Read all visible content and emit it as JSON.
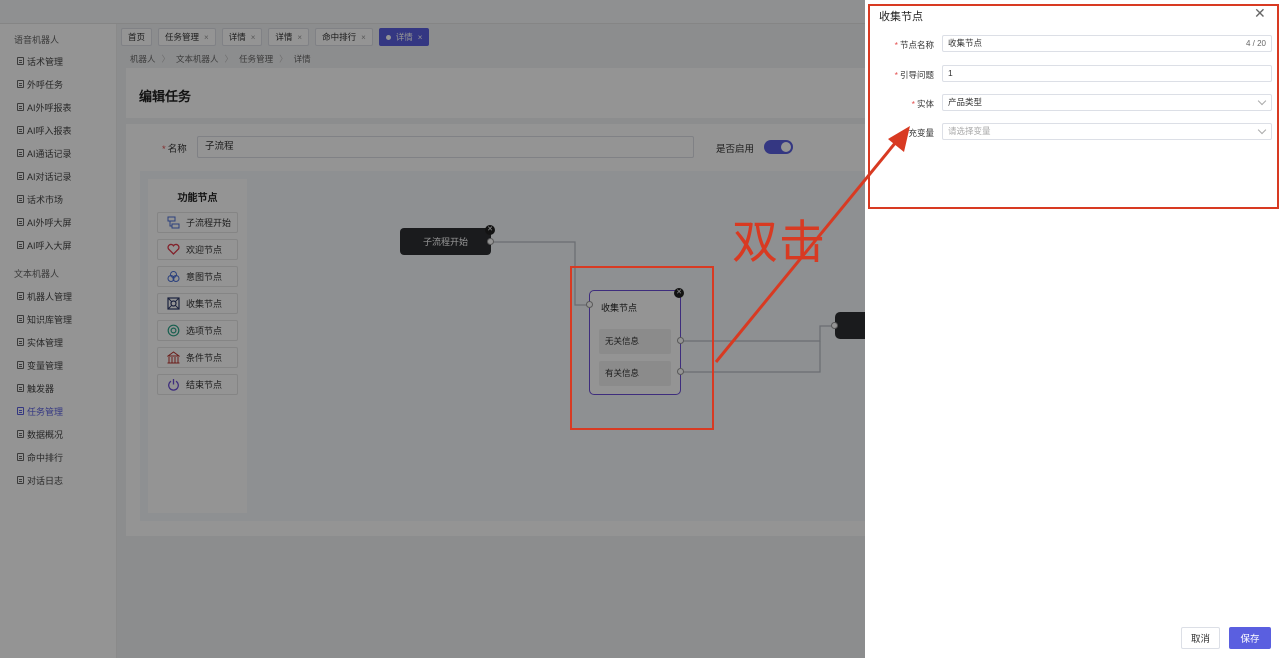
{
  "sidebar": {
    "sections": [
      "语音机器人",
      "文本机器人"
    ],
    "voice_items": [
      "话术管理",
      "外呼任务",
      "AI外呼报表",
      "AI呼入报表",
      "AI通话记录",
      "AI对话记录",
      "话术市场",
      "AI外呼大屏",
      "AI呼入大屏"
    ],
    "text_items": [
      "机器人管理",
      "知识库管理",
      "实体管理",
      "变量管理",
      "触发器",
      "任务管理",
      "数据概况",
      "命中排行",
      "对话日志"
    ],
    "active_item": "任务管理"
  },
  "tabs": [
    {
      "label": "首页",
      "closable": false,
      "active": false
    },
    {
      "label": "任务管理",
      "closable": true,
      "active": false
    },
    {
      "label": "详情",
      "closable": true,
      "active": false
    },
    {
      "label": "详情",
      "closable": true,
      "active": false
    },
    {
      "label": "命中排行",
      "closable": true,
      "active": false
    },
    {
      "label": "详情",
      "closable": true,
      "active": true
    }
  ],
  "tab_close_glyph": "×",
  "breadcrumb": [
    "机器人",
    "文本机器人",
    "任务管理",
    "详情"
  ],
  "breadcrumb_sep": "〉",
  "page": {
    "title": "编辑任务",
    "name_label": "名称",
    "name_value": "子流程",
    "enable_label": "是否启用",
    "enabled": true
  },
  "palette": {
    "title": "功能节点",
    "items": [
      {
        "label": "子流程开始",
        "icon": "subflow-icon"
      },
      {
        "label": "欢迎节点",
        "icon": "heart-icon"
      },
      {
        "label": "意图节点",
        "icon": "intent-icon"
      },
      {
        "label": "收集节点",
        "icon": "collect-icon"
      },
      {
        "label": "选项节点",
        "icon": "option-icon"
      },
      {
        "label": "条件节点",
        "icon": "condition-icon"
      },
      {
        "label": "结束节点",
        "icon": "power-icon"
      }
    ]
  },
  "flow": {
    "start_node": "子流程开始",
    "collect_node": {
      "title": "收集节点",
      "options": [
        "无关信息",
        "有关信息"
      ]
    }
  },
  "annotation": {
    "text": "双击",
    "color": "#d83a22"
  },
  "drawer": {
    "title": "收集节点",
    "close_glyph": "✕",
    "fields": {
      "node_name": {
        "label": "节点名称",
        "value": "收集节点",
        "counter": "4 / 20",
        "required": true
      },
      "guide_question": {
        "label": "引导问题",
        "value": "1",
        "required": true
      },
      "entity": {
        "label": "实体",
        "value": "产品类型",
        "required": true
      },
      "fill_variable": {
        "label": "充变量",
        "placeholder": "请选择变量",
        "required": false
      }
    },
    "cancel_label": "取消",
    "save_label": "保存"
  },
  "colors": {
    "accent": "#5a5fe0",
    "annotation_red": "#d83a22",
    "node_border": "#6b4fd8"
  }
}
